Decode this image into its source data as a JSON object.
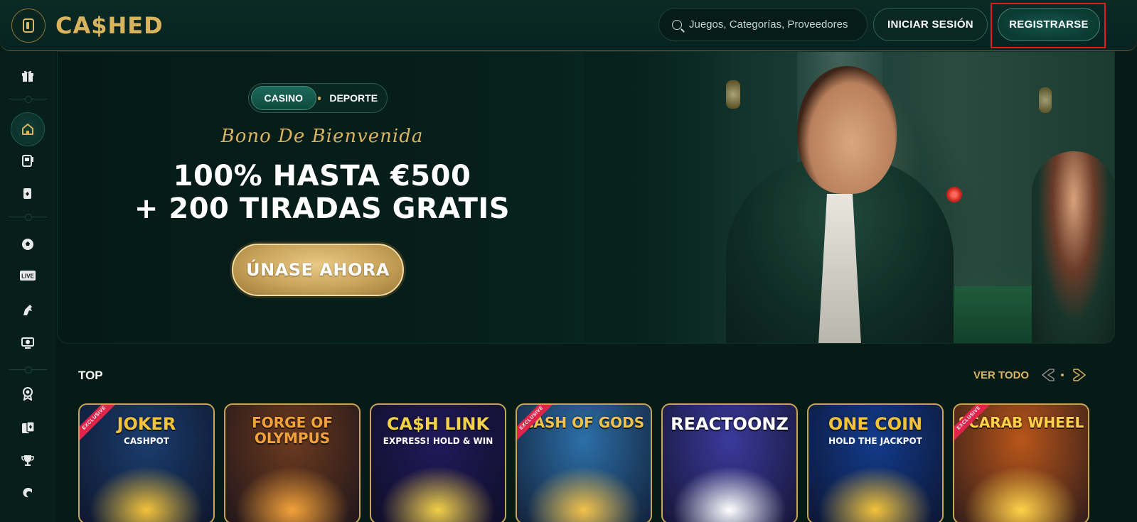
{
  "header": {
    "logo_text": "CA$HED",
    "search_placeholder": "Juegos, Categorías, Proveedores",
    "login_label": "INICIAR SESIÓN",
    "register_label": "REGISTRARSE"
  },
  "sidebar": {
    "items": [
      {
        "icon": "gift-icon"
      },
      {
        "icon": "home-icon"
      },
      {
        "icon": "slot-machine-icon"
      },
      {
        "icon": "cards-icon"
      },
      {
        "icon": "soccer-ball-icon"
      },
      {
        "icon": "live-icon",
        "label": "LIVE"
      },
      {
        "icon": "horse-icon"
      },
      {
        "icon": "virtual-sports-icon"
      },
      {
        "icon": "badge-icon"
      },
      {
        "icon": "playing-cards-icon"
      },
      {
        "icon": "trophy-icon"
      },
      {
        "icon": "cashback-icon"
      }
    ]
  },
  "hero": {
    "tabs": [
      "CASINO",
      "DEPORTE"
    ],
    "bonus_script": "Bono De Bienvenida",
    "offer_line1": "100% HASTA €500",
    "offer_line2": "+ 200 TIRADAS GRATIS",
    "cta_label": "ÚNASE AHORA"
  },
  "top_section": {
    "title": "TOP",
    "see_all": "VER TODO",
    "games": [
      {
        "title": "JOKER",
        "subtitle": "CASHPOT",
        "badge": "EXCLUSIVE",
        "bg": "#1a3d6e",
        "accent": "#f2c23a"
      },
      {
        "title": "FORGE OF OLYMPUS",
        "subtitle": "",
        "badge": "",
        "bg": "#6b3a1e",
        "accent": "#f2a23a"
      },
      {
        "title": "CA$H LINK",
        "subtitle": "EXPRESS! HOLD & WIN",
        "badge": "",
        "bg": "#21195a",
        "accent": "#f1d04a"
      },
      {
        "title": "CASH OF GODS",
        "subtitle": "",
        "badge": "EXCLUSIVE",
        "bg": "#2c6fa8",
        "accent": "#f3c24a"
      },
      {
        "title": "REACTOONZ",
        "subtitle": "",
        "badge": "",
        "bg": "#3a3a9c",
        "accent": "#ffffff"
      },
      {
        "title": "ONE COIN",
        "subtitle": "HOLD THE JACKPOT",
        "badge": "",
        "bg": "#123b8c",
        "accent": "#f2c23a"
      },
      {
        "title": "SCARAB WHEEL",
        "subtitle": "",
        "badge": "EXCLUSIVE",
        "bg": "#b8561a",
        "accent": "#ffd24a"
      }
    ]
  },
  "colors": {
    "background": "#061a16",
    "gold": "#d9b360",
    "highlight": "#e11c1c"
  }
}
